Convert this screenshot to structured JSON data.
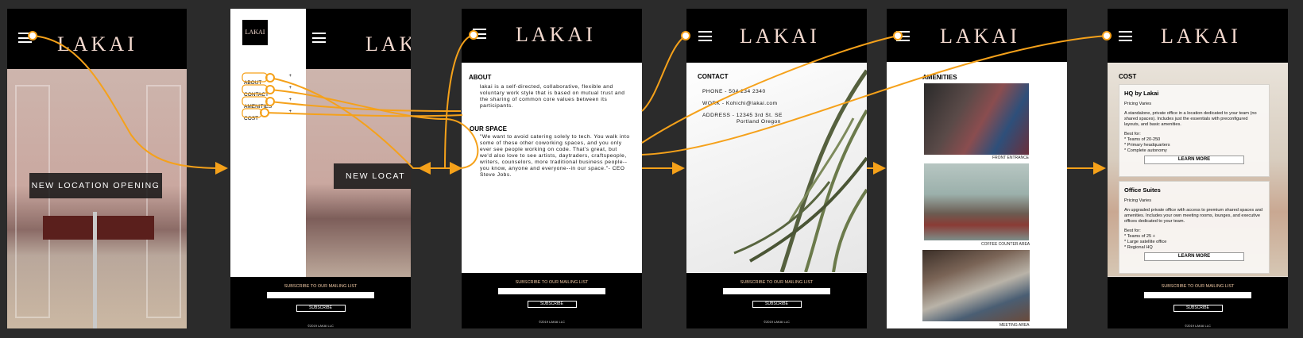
{
  "brand": "LAKAI",
  "logo_box_text": "LAKAI",
  "hero_banner": "NEW LOCATION OPENING",
  "hero_banner_partial": "NEW LOCAT",
  "menu_items": [
    "ABOUT",
    "CONTACT",
    "AMENITIES",
    "COST"
  ],
  "about": {
    "heading": "ABOUT",
    "body": "lakai is a self-directed, collaborative, flexible and voluntary work style that is based on mutual trust and the sharing of common core values between its participants.",
    "space_heading": "OUR SPACE",
    "space_body": "\"We want to avoid catering solely to tech. You walk into some of these other coworking spaces, and you only ever see people working on code. That's great, but we'd also love to see artists, daytraders, craftspeople, writers, counselors, more traditional business people--you know, anyone and everyone--in our space.\"- CEO Steve Jobs."
  },
  "contact": {
    "heading": "CONTACT",
    "phone": "PHONE - 504 234 2340",
    "work": "WORK - Kohichi@lakai.com",
    "address_line1": "ADDRESS - 12345 3rd St. SE",
    "address_line2": "Portland Oregon"
  },
  "amenities": {
    "heading": "AMENITIES",
    "captions": [
      "FRONT ENTRANCE",
      "COFFEE COUNTER AREA",
      "MEETING AREA"
    ]
  },
  "cost": {
    "heading": "COST",
    "plans": [
      {
        "title": "HQ by Lakai",
        "pricing": "Pricing Varies",
        "desc": "A standalone, private office in a location dedicated to your team (no shared spaces). Includes just the essentials with preconfigured layouts, and basic amenities.",
        "best_for": "Best for:",
        "bullets": [
          "* Teams of 20-250",
          "* Primary headquarters",
          "* Complete autonomy"
        ],
        "button": "LEARN MORE"
      },
      {
        "title": "Office Suites",
        "pricing": "Pricing Varies",
        "desc": "An upgraded private office with access to premium shared spaces and amenities. Includes your own meeting rooms, lounges, and executive offices dedicated to your team.",
        "best_for": "Best for:",
        "bullets": [
          "* Teams of 25 +",
          "* Large satellite office",
          "* Regional HQ"
        ],
        "button": "LEARN MORE"
      }
    ]
  },
  "footer": {
    "subscribe_label": "SUBSCRIBE TO OUR MAILING LIST",
    "subscribe_button": "SUBSCRIBE",
    "copyright": "©2019 LAKAI LLC"
  },
  "colors": {
    "canvas": "#2b2b2b",
    "header": "#000000",
    "brand_text": "#f3d9cf",
    "flow_link": "#f5a11a"
  }
}
